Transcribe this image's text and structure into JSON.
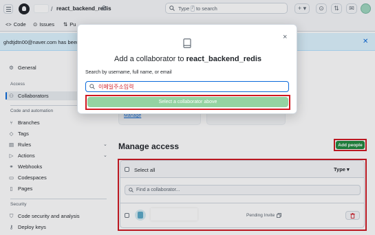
{
  "header": {
    "repo_name": "react_backend_redis",
    "search_prefix": "Type",
    "search_key": "/",
    "search_suffix": "to search"
  },
  "repo_nav": {
    "tabs": [
      {
        "label": "Code",
        "icon": "code-icon"
      },
      {
        "label": "Issues",
        "icon": "issue-icon"
      },
      {
        "label": "Pu",
        "icon": "pull-request-icon"
      }
    ]
  },
  "flash": {
    "text": "ghdtjdtn00@naver.com has been a"
  },
  "sidebar": {
    "general": "General",
    "access_heading": "Access",
    "collaborators": "Collaborators",
    "code_heading": "Code and automation",
    "items": [
      {
        "label": "Branches",
        "icon": "branch-icon"
      },
      {
        "label": "Tags",
        "icon": "tag-icon"
      },
      {
        "label": "Rules",
        "icon": "rules-icon"
      },
      {
        "label": "Actions",
        "icon": "actions-icon"
      },
      {
        "label": "Webhooks",
        "icon": "webhook-icon"
      },
      {
        "label": "Codespaces",
        "icon": "codespaces-icon"
      },
      {
        "label": "Pages",
        "icon": "pages-icon"
      }
    ],
    "security_heading": "Security",
    "security_items": [
      {
        "label": "Code security and analysis",
        "icon": "shield-icon"
      },
      {
        "label": "Deploy keys",
        "icon": "key-icon"
      }
    ]
  },
  "main": {
    "manage_link": "Manage",
    "manage_access_title": "Manage access",
    "add_people_label": "Add people",
    "select_all_label": "Select all",
    "type_filter_label": "Type",
    "find_placeholder": "Find a collaborator...",
    "row_status": "Pending Invite"
  },
  "modal": {
    "title_prefix": "Add a collaborator to",
    "title_repo": "react_backend_redis",
    "search_label": "Search by username, full name, or email",
    "input_value": "이메일주소입력",
    "select_button_label": "Select a collaborator above",
    "close_glyph": "×"
  },
  "colors": {
    "accent": "#0969da",
    "primary_button": "#1f883d",
    "disabled_button": "#94d3a2",
    "annotation_red": "#d0161f"
  }
}
